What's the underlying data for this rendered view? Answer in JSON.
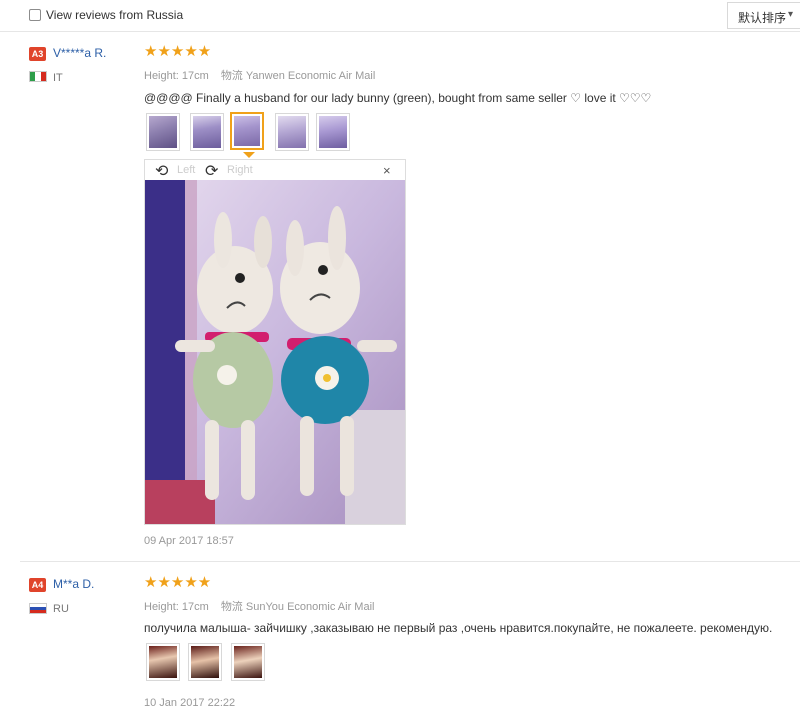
{
  "filter": {
    "label": "View reviews from Russia",
    "checked": false
  },
  "sort": {
    "label": "默认排序",
    "caret": "▾"
  },
  "reviews": [
    {
      "rank": "A3",
      "user": "V*****a R.",
      "country": "IT",
      "stars": "★★★★★",
      "height": "Height: 17cm",
      "shipping_label": "物流",
      "shipping": "Yanwen Economic Air Mail",
      "comment": "@@@@ Finally a husband for our lady bunny (green), bought from same seller ♡ love it ♡♡♡",
      "date": "09 Apr 2017 18:57",
      "viewer": {
        "left": "Left",
        "right": "Right",
        "close": "×"
      }
    },
    {
      "rank": "A4",
      "user": "M**a D.",
      "country": "RU",
      "stars": "★★★★★",
      "height": "Height: 17cm",
      "shipping_label": "物流",
      "shipping": "SunYou Economic Air Mail",
      "comment": "получила малыша- зайчишку ,заказываю не первый раз ,очень нравится.покупайте, не пожалеете. рекомендую.",
      "date": "10 Jan 2017 22:22"
    }
  ],
  "colors": {
    "rank_badge": "#e0442b",
    "username": "#2d5fa7",
    "stars": "#f0a11a",
    "active_thumb": "#f0a11a"
  }
}
